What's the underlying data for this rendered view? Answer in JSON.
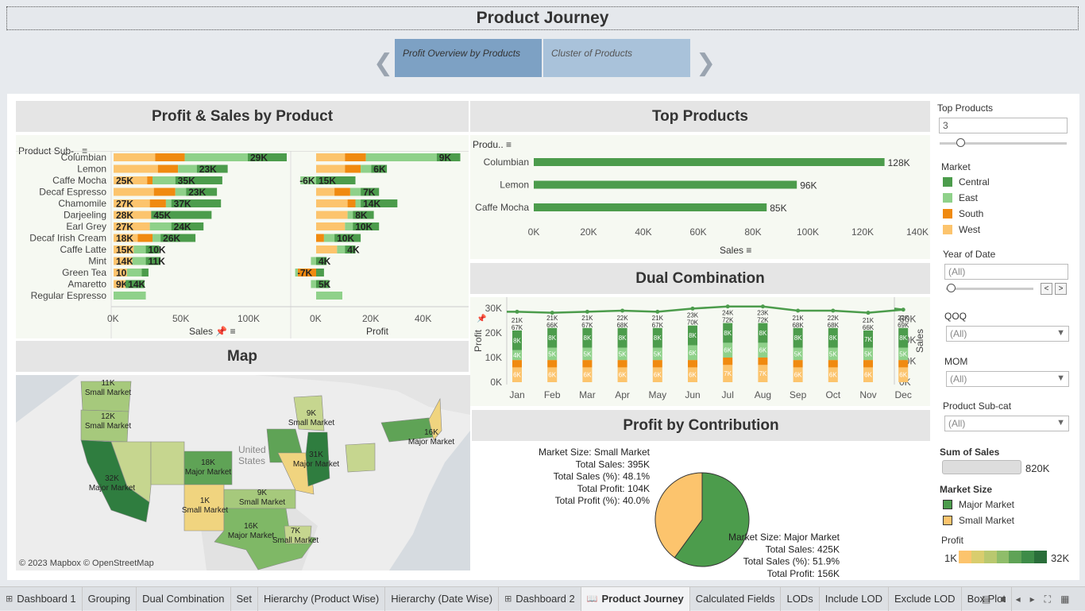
{
  "story": {
    "title": "Product Journey",
    "points": [
      "Profit Overview by Products",
      "Cluster of Products"
    ]
  },
  "panels": {
    "profit_sales": "Profit & Sales by Product",
    "map": "Map",
    "top_products": "Top Products",
    "dual": "Dual Combination",
    "contribution": "Profit by Contribution"
  },
  "profit_sales": {
    "row_header": "Product  Sub-..",
    "sales_axis_label": "Sales",
    "profit_axis_label": "Profit",
    "sales_ticks": [
      "0K",
      "50K",
      "100K"
    ],
    "profit_ticks": [
      "0K",
      "20K",
      "40K"
    ]
  },
  "map": {
    "attribution": "© 2023 Mapbox © OpenStreetMap",
    "place_label": "United States",
    "labels": [
      {
        "value": "11K",
        "size": "Small Market"
      },
      {
        "value": "12K",
        "size": "Small Market"
      },
      {
        "value": "32K",
        "size": "Major Market"
      },
      {
        "value": "18K",
        "size": "Major Market"
      },
      {
        "value": "1K",
        "size": "Small Market"
      },
      {
        "value": "9K",
        "size": "Small Market"
      },
      {
        "value": "16K",
        "size": "Major Market"
      },
      {
        "value": "7K",
        "size": "Small Market"
      },
      {
        "value": "31K",
        "size": "Major Market"
      },
      {
        "value": "9K",
        "size": "Small Market"
      },
      {
        "value": "16K",
        "size": "Major Market"
      }
    ]
  },
  "top_products": {
    "row_header": "Produ..",
    "axis_label": "Sales",
    "ticks": [
      "0K",
      "20K",
      "40K",
      "60K",
      "80K",
      "100K",
      "120K",
      "140K"
    ]
  },
  "dual": {
    "left_axis_label": "Profit",
    "right_axis_label": "Sales",
    "left_ticks": [
      "0K",
      "10K",
      "20K",
      "30K"
    ],
    "right_ticks": [
      "0K",
      "20K",
      "40K",
      "60K"
    ]
  },
  "contribution": {
    "small": [
      "Market Size: Small Market",
      "Total Sales: 395K",
      "Total Sales (%): 48.1%",
      "Total Profit: 104K",
      "Total Profit (%): 40.0%"
    ],
    "major": [
      "Market Size: Major Market",
      "Total Sales: 425K",
      "Total Sales (%): 51.9%",
      "Total Profit: 156K"
    ]
  },
  "controls": {
    "top_products_label": "Top Products",
    "top_products_value": "3",
    "market_label": "Market",
    "markets": [
      {
        "name": "Central",
        "color": "#4c9c4c"
      },
      {
        "name": "East",
        "color": "#8fd18a"
      },
      {
        "name": "South",
        "color": "#f08a10"
      },
      {
        "name": "West",
        "color": "#fcc46d"
      }
    ],
    "year_label": "Year of Date",
    "year_value": "(All)",
    "qoq_label": "QOQ",
    "qoq_value": "(All)",
    "mom_label": "MOM",
    "mom_value": "(All)",
    "subcat_label": "Product  Sub-cat",
    "subcat_value": "(All)",
    "sum_sales_label": "Sum of Sales",
    "sum_sales_value": "820K",
    "market_size_label": "Market Size",
    "market_sizes": [
      {
        "name": "Major Market",
        "color": "#4c9c4c"
      },
      {
        "name": "Small Market",
        "color": "#fcc46d"
      }
    ],
    "profit_label": "Profit",
    "profit_min": "1K",
    "profit_max": "32K"
  },
  "tabs": [
    "Dashboard 1",
    "Grouping",
    "Dual Combination",
    "Set",
    "Hierarchy (Product Wise)",
    "Hierarchy (Date Wise)",
    "Dashboard 2",
    "Product Journey",
    "Calculated Fields",
    "LODs",
    "Include LOD",
    "Exclude LOD",
    "Box Plot"
  ],
  "active_tab": "Product Journey",
  "chart_data": [
    {
      "type": "bar",
      "title": "Profit & Sales by Product",
      "categories": [
        "Columbian",
        "Lemon",
        "Caffe Mocha",
        "Decaf Espresso",
        "Chamomile",
        "Darjeeling",
        "Earl Grey",
        "Decaf Irish Cream",
        "Caffe Latte",
        "Mint",
        "Green Tea",
        "Amaretto",
        "Regular Espresso"
      ],
      "stacked": true,
      "sales_series": [
        {
          "name": "West",
          "values": [
            31,
            33,
            25,
            30,
            27,
            28,
            27,
            18,
            15,
            14,
            10,
            9,
            0
          ]
        },
        {
          "name": "South",
          "values": [
            22,
            15,
            4,
            16,
            12,
            0,
            0,
            11,
            0,
            0,
            0,
            0,
            0
          ]
        },
        {
          "name": "East",
          "values": [
            47,
            14,
            17,
            8,
            4,
            0,
            16,
            6,
            9,
            10,
            11,
            0,
            24
          ]
        },
        {
          "name": "Central",
          "values": [
            29,
            23,
            35,
            23,
            37,
            45,
            24,
            26,
            10,
            11,
            5,
            14,
            0
          ]
        }
      ],
      "profit_series": [
        {
          "name": "West",
          "values": [
            11,
            11,
            0,
            7,
            12,
            12,
            11,
            0,
            8,
            0,
            0,
            0,
            0
          ]
        },
        {
          "name": "South",
          "values": [
            8,
            6,
            0,
            6,
            3,
            0,
            0,
            3,
            0,
            0,
            -7,
            0,
            0
          ]
        },
        {
          "name": "East",
          "values": [
            27,
            4,
            -6,
            4,
            2,
            2,
            3,
            4,
            3,
            -2,
            -1,
            -2,
            10
          ]
        },
        {
          "name": "Central",
          "values": [
            9,
            6,
            15,
            7,
            14,
            8,
            10,
            10,
            4,
            4,
            3,
            5,
            0
          ]
        }
      ],
      "xlabel": "Sales"
    },
    {
      "type": "bar",
      "title": "Top Products",
      "categories": [
        "Columbian",
        "Lemon",
        "Caffe Mocha"
      ],
      "values": [
        128,
        96,
        85
      ],
      "labels": [
        "128K",
        "96K",
        "85K"
      ],
      "xlabel": "Sales",
      "xlim": [
        0,
        140
      ]
    },
    {
      "type": "bar",
      "title": "Dual Combination",
      "categories": [
        "Jan",
        "Feb",
        "Mar",
        "Apr",
        "May",
        "Jun",
        "Jul",
        "Aug",
        "Sep",
        "Oct",
        "Nov",
        "Dec"
      ],
      "series": [
        {
          "name": "West",
          "values": [
            6,
            6,
            6,
            6,
            6,
            6,
            7,
            7,
            6,
            6,
            6,
            6
          ]
        },
        {
          "name": "South",
          "values": [
            3,
            3,
            3,
            3,
            3,
            3,
            3,
            3,
            3,
            3,
            3,
            3
          ]
        },
        {
          "name": "East",
          "values": [
            4,
            5,
            5,
            5,
            5,
            6,
            6,
            6,
            5,
            5,
            5,
            5
          ]
        },
        {
          "name": "Central",
          "values": [
            8,
            8,
            8,
            8,
            8,
            8,
            8,
            8,
            8,
            8,
            7,
            8
          ]
        }
      ],
      "totals": [
        "21K",
        "21K",
        "21K",
        "22K",
        "21K",
        "23K",
        "24K",
        "23K",
        "21K",
        "22K",
        "21K",
        "22K"
      ],
      "sales_labels": [
        "67K",
        "66K",
        "67K",
        "68K",
        "67K",
        "70K",
        "72K",
        "72K",
        "68K",
        "68K",
        "66K",
        "69K"
      ],
      "sales_line": [
        67,
        66,
        67,
        68,
        67,
        70,
        72,
        72,
        68,
        68,
        66,
        69
      ],
      "ylabel": "Profit",
      "ylim": [
        0,
        30
      ],
      "y2label": "Sales",
      "y2lim": [
        0,
        70
      ]
    },
    {
      "type": "pie",
      "title": "Profit by Contribution",
      "categories": [
        "Major Market",
        "Small Market"
      ],
      "values": [
        60.0,
        40.0
      ]
    }
  ]
}
